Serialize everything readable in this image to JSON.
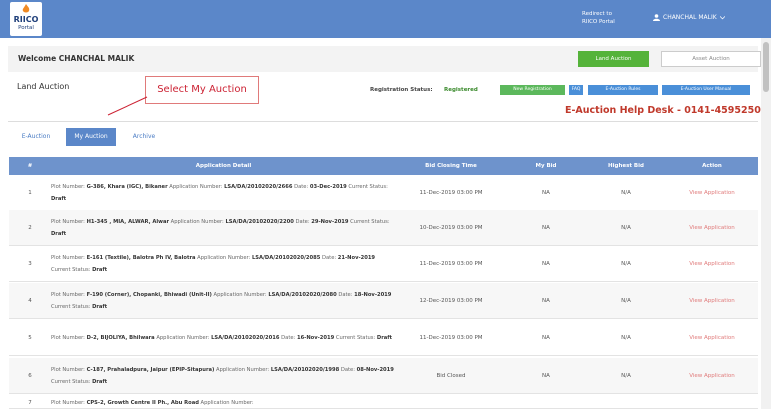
{
  "header": {
    "logo_text": "RIICO",
    "logo_sub": "Portal",
    "redirect_line1": "Redirect to",
    "redirect_line2": "RIICO Portal",
    "user_name": "CHANCHAL MALIK"
  },
  "welcome": {
    "text": "Welcome CHANCHAL MALIK",
    "land_button": "Land Auction",
    "asset_button": "Asset Auction"
  },
  "section": {
    "title": "Land Auction",
    "callout": "Select My Auction",
    "registration_label": "Registration Status:",
    "registration_value": "Registered",
    "new_registration": "New Registration",
    "faq": "FAQ",
    "rules": "E-Auction Rules",
    "manual": "E-Auction User Manual",
    "helpdesk": "E-Auction Help Desk - 0141-4595250"
  },
  "tabs": [
    "E-Auction",
    "My Auction",
    "Archive"
  ],
  "table": {
    "headers": [
      "#",
      "Application Detail",
      "Bid Closing Time",
      "My Bid",
      "Highest Bid",
      "Action"
    ],
    "rows": [
      {
        "num": "1",
        "plot": "G-386, Khara (IGC), Bikaner",
        "app": "LSA/DA/20102020/2666",
        "date": "03-Dec-2019",
        "status": "Draft",
        "closing": "11-Dec-2019 03:00 PM",
        "my_bid": "NA",
        "highest": "N/A",
        "action": "View Application"
      },
      {
        "num": "2",
        "plot": "H1-345 , MIA, ALWAR, Alwar",
        "app": "LSA/DA/20102020/2200",
        "date": "29-Nov-2019",
        "status": "Draft",
        "closing": "10-Dec-2019 03:00 PM",
        "my_bid": "NA",
        "highest": "N/A",
        "action": "View Application"
      },
      {
        "num": "3",
        "plot": "E-161 (Textile), Balotra Ph IV, Balotra",
        "app": "LSA/DA/20102020/2085",
        "date": "21-Nov-2019",
        "status": "Draft",
        "closing": "11-Dec-2019 03:00 PM",
        "my_bid": "NA",
        "highest": "N/A",
        "action": "View Application"
      },
      {
        "num": "4",
        "plot": "F-190 (Corner), Chopanki, Bhiwadi (Unit-II)",
        "app": "LSA/DA/20102020/2080",
        "date": "18-Nov-2019",
        "status": "Draft",
        "closing": "12-Dec-2019 03:00 PM",
        "my_bid": "NA",
        "highest": "N/A",
        "action": "View Application"
      },
      {
        "num": "5",
        "plot": "D-2, BIJOLIYA, Bhilwara",
        "app": "LSA/DA/20102020/2016",
        "date": "16-Nov-2019",
        "status": "Draft",
        "closing": "11-Dec-2019 03:00 PM",
        "my_bid": "NA",
        "highest": "N/A",
        "action": "View Application"
      },
      {
        "num": "6",
        "plot": "C-187, Prahaladpura, Jaipur (EPIP-Sitapura)",
        "app": "LSA/DA/20102020/1998",
        "date": "08-Nov-2019",
        "status": "Draft",
        "closing": "Bid Closed",
        "my_bid": "NA",
        "highest": "N/A",
        "action": "View Application"
      },
      {
        "num": "7",
        "plot": "CPS-2, Growth Centre II Ph., Abu Road",
        "app": "",
        "date": "",
        "status": "",
        "closing": "",
        "my_bid": "",
        "highest": "",
        "action": ""
      }
    ]
  },
  "colors": {
    "header_bg": "#5b87c9",
    "table_header_bg": "#6e93cc",
    "green": "#55b33a",
    "helpdesk_red": "#c0392b"
  }
}
